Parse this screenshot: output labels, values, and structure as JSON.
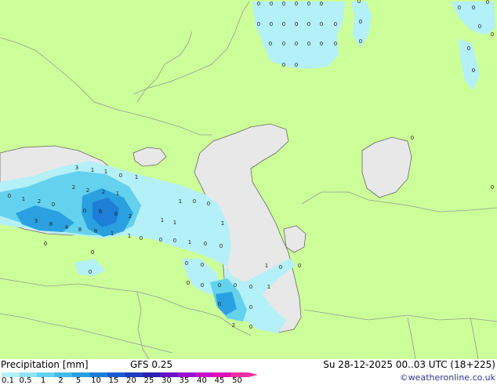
{
  "legend": {
    "title": "Precipitation [mm]",
    "model": "GFS 0.25",
    "datetime": "Su 28-12-2025 00..03 UTC (18+225)",
    "credit": "©weatheronline.co.uk",
    "scale": [
      {
        "label": "0.1",
        "color": "#b4f0f7"
      },
      {
        "label": "0.5",
        "color": "#8ee3f2"
      },
      {
        "label": "1",
        "color": "#64d2ee"
      },
      {
        "label": "2",
        "color": "#40bce8"
      },
      {
        "label": "5",
        "color": "#2aa0e0"
      },
      {
        "label": "10",
        "color": "#1e7ed8"
      },
      {
        "label": "15",
        "color": "#1c5ccf"
      },
      {
        "label": "20",
        "color": "#1e3dbf"
      },
      {
        "label": "25",
        "color": "#2a22b0"
      },
      {
        "label": "30",
        "color": "#6a10c8"
      },
      {
        "label": "35",
        "color": "#9a10d0"
      },
      {
        "label": "40",
        "color": "#c810c8"
      },
      {
        "label": "45",
        "color": "#e010b8"
      },
      {
        "label": "50",
        "color": "#f030a0"
      }
    ]
  },
  "colors": {
    "land": "#ccff99",
    "sea": "#e8e8e8",
    "border": "#999999",
    "coast": "#666666"
  },
  "point_values": [
    "0",
    "0",
    "0",
    "0",
    "0",
    "0",
    "0",
    "0",
    "0",
    "0",
    "0",
    "0",
    "0",
    "0",
    "0",
    "0",
    "0",
    "0",
    "0",
    "0",
    "0",
    "0",
    "0",
    "0",
    "0",
    "0",
    "0",
    "0",
    "0",
    "0",
    "0",
    "0",
    "3",
    "1",
    "1",
    "0",
    "1",
    "2",
    "2",
    "2",
    "1",
    "0",
    "1",
    "2",
    "0",
    "6",
    "6",
    "2",
    "0",
    "3",
    "8",
    "4",
    "8",
    "8",
    "1",
    "1",
    "0",
    "0",
    "1",
    "0",
    "0",
    "1",
    "1",
    "1",
    "0",
    "1",
    "0",
    "0",
    "0",
    "0",
    "0",
    "0",
    "1",
    "0",
    "0",
    "0",
    "0",
    "0",
    "0",
    "0",
    "1",
    "0",
    "0",
    "0",
    "2",
    "0",
    "0",
    "0",
    "0"
  ]
}
